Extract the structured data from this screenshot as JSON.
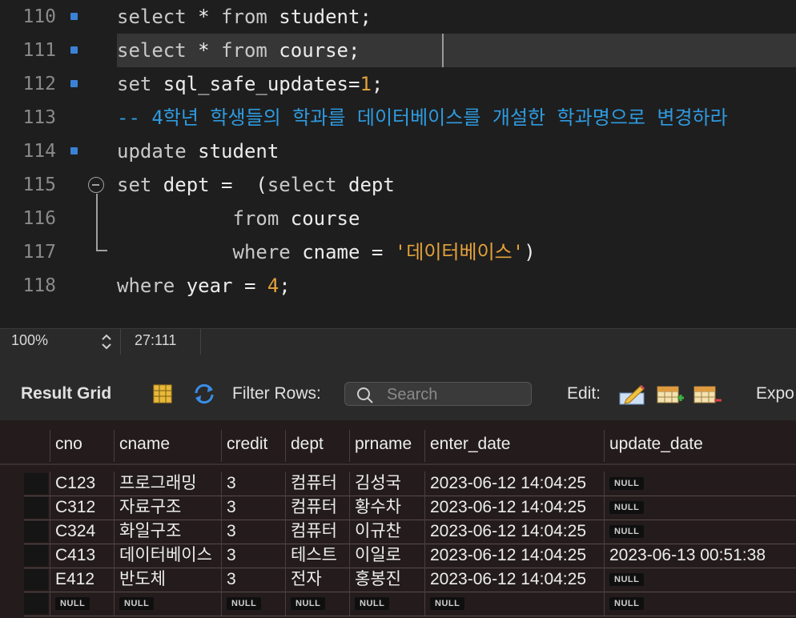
{
  "editor": {
    "lines": [
      {
        "num": "110",
        "breakpoint": true,
        "tokens": [
          {
            "t": "select",
            "c": "kw"
          },
          {
            "t": " * ",
            "c": "plain"
          },
          {
            "t": "from",
            "c": "kw"
          },
          {
            "t": " student;",
            "c": "plain"
          }
        ]
      },
      {
        "num": "111",
        "breakpoint": true,
        "highlight": true,
        "tokens": [
          {
            "t": "select",
            "c": "kw"
          },
          {
            "t": " * ",
            "c": "plain"
          },
          {
            "t": "from",
            "c": "kw"
          },
          {
            "t": " course;",
            "c": "plain"
          }
        ]
      },
      {
        "num": "112",
        "breakpoint": true,
        "tokens": [
          {
            "t": "set",
            "c": "kw"
          },
          {
            "t": " sql_safe_updates=",
            "c": "plain"
          },
          {
            "t": "1",
            "c": "num"
          },
          {
            "t": ";",
            "c": "plain"
          }
        ]
      },
      {
        "num": "113",
        "breakpoint": false,
        "tokens": [
          {
            "t": "-- 4학년 학생들의 학과를 데이터베이스를 개설한 학과명으로 변경하라",
            "c": "cmt"
          }
        ]
      },
      {
        "num": "114",
        "breakpoint": true,
        "tokens": [
          {
            "t": "update",
            "c": "kw"
          },
          {
            "t": " student",
            "c": "plain"
          }
        ]
      },
      {
        "num": "115",
        "breakpoint": false,
        "tokens": [
          {
            "t": "set",
            "c": "kw"
          },
          {
            "t": " dept =  (",
            "c": "plain"
          },
          {
            "t": "select",
            "c": "kw"
          },
          {
            "t": " dept",
            "c": "plain"
          }
        ]
      },
      {
        "num": "116",
        "breakpoint": false,
        "tokens": [
          {
            "t": "          ",
            "c": "plain"
          },
          {
            "t": "from",
            "c": "kw"
          },
          {
            "t": " course",
            "c": "plain"
          }
        ]
      },
      {
        "num": "117",
        "breakpoint": false,
        "tokens": [
          {
            "t": "          ",
            "c": "plain"
          },
          {
            "t": "where",
            "c": "kw"
          },
          {
            "t": " cname = ",
            "c": "plain"
          },
          {
            "t": "'데이터베이스'",
            "c": "str"
          },
          {
            "t": ")",
            "c": "plain"
          }
        ]
      },
      {
        "num": "118",
        "breakpoint": false,
        "tokens": [
          {
            "t": "where",
            "c": "kw"
          },
          {
            "t": " year = ",
            "c": "plain"
          },
          {
            "t": "4",
            "c": "num"
          },
          {
            "t": ";",
            "c": "plain"
          }
        ]
      }
    ]
  },
  "status": {
    "zoom": "100%",
    "cursor": "27:111"
  },
  "toolbar": {
    "result_grid": "Result Grid",
    "filter_rows": "Filter Rows:",
    "search_placeholder": "Search",
    "edit": "Edit:",
    "export": "Expo"
  },
  "grid": {
    "columns": [
      "cno",
      "cname",
      "credit",
      "dept",
      "prname",
      "enter_date",
      "update_date"
    ],
    "rows": [
      [
        "C123",
        "프로그래밍",
        "3",
        "컴퓨터",
        "김성국",
        "2023-06-12 14:04:25",
        null
      ],
      [
        "C312",
        "자료구조",
        "3",
        "컴퓨터",
        "황수차",
        "2023-06-12 14:04:25",
        null
      ],
      [
        "C324",
        "화일구조",
        "3",
        "컴퓨터",
        "이규찬",
        "2023-06-12 14:04:25",
        null
      ],
      [
        "C413",
        "데이터베이스",
        "3",
        "테스트",
        "이일로",
        "2023-06-12 14:04:25",
        "2023-06-13 00:51:38"
      ],
      [
        "E412",
        "반도체",
        "3",
        "전자",
        "홍봉진",
        "2023-06-12 14:04:25",
        null
      ],
      [
        null,
        null,
        null,
        null,
        null,
        null,
        null
      ]
    ],
    "null_label": "NULL"
  }
}
